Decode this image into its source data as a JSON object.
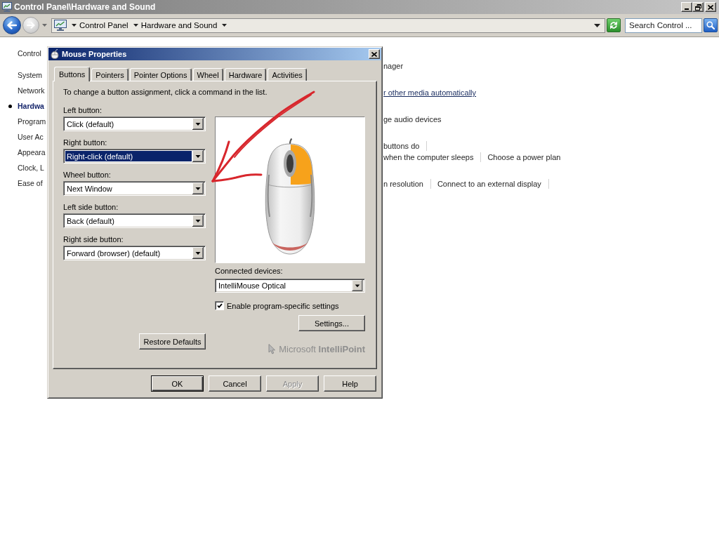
{
  "window": {
    "title": "Control Panel\\Hardware and Sound"
  },
  "address_bar": {
    "back": {
      "disabled": false
    },
    "forward": {
      "disabled": true
    },
    "breadcrumbs": [
      "Control Panel",
      "Hardware and Sound"
    ],
    "search": {
      "placeholder": "Search Control ..."
    }
  },
  "sidebar": {
    "items": [
      {
        "kind": "home",
        "label": "Control",
        "selected": false
      },
      {
        "kind": "category",
        "label": "System",
        "selected": false
      },
      {
        "kind": "category",
        "label": "Network",
        "selected": false
      },
      {
        "kind": "category",
        "label": "Hardwa",
        "selected": true
      },
      {
        "kind": "category",
        "label": "Program",
        "selected": false
      },
      {
        "kind": "category",
        "label": "User Ac",
        "selected": false
      },
      {
        "kind": "category",
        "label": "Appeara",
        "selected": false
      },
      {
        "kind": "category",
        "label": "Clock, L",
        "selected": false
      },
      {
        "kind": "category",
        "label": "Ease of",
        "selected": false
      }
    ]
  },
  "content": {
    "groups": [
      {
        "lines": [
          [
            {
              "label": "nager",
              "underlined": false,
              "divider": false
            }
          ]
        ]
      },
      {
        "lines": [
          [
            {
              "label": "r other media automatically",
              "underlined": true,
              "divider": false
            }
          ]
        ]
      },
      {
        "lines": [
          [
            {
              "label": "ge audio devices",
              "underlined": false,
              "divider": false
            }
          ]
        ]
      },
      {
        "lines": [
          [
            {
              "label": "buttons do",
              "underlined": false,
              "divider": true
            }
          ],
          [
            {
              "label": "when the computer sleeps",
              "underlined": false,
              "divider": true
            },
            {
              "label": "Choose a power plan",
              "underlined": false,
              "divider": false
            }
          ]
        ]
      },
      {
        "lines": [
          [
            {
              "label": "n resolution",
              "underlined": false,
              "divider": true
            },
            {
              "label": "Connect to an external display",
              "underlined": false,
              "divider": true
            }
          ]
        ]
      }
    ]
  },
  "dialog": {
    "title": "Mouse Properties",
    "tabs": [
      {
        "label": "Buttons",
        "selected": true
      },
      {
        "label": "Pointers",
        "selected": false
      },
      {
        "label": "Pointer Options",
        "selected": false
      },
      {
        "label": "Wheel",
        "selected": false
      },
      {
        "label": "Hardware",
        "selected": false
      },
      {
        "label": "Activities",
        "selected": false
      }
    ],
    "instruction": "To change a button assignment, click a command in the list.",
    "assignments": [
      {
        "label": "Left button:",
        "value": "Click (default)",
        "focused": false
      },
      {
        "label": "Right button:",
        "value": "Right-click (default)",
        "focused": true
      },
      {
        "label": "Wheel button:",
        "value": "Next Window",
        "focused": false
      },
      {
        "label": "Left side button:",
        "value": "Back (default)",
        "focused": false
      },
      {
        "label": "Right side button:",
        "value": "Forward (browser) (default)",
        "focused": false
      }
    ],
    "restore_button": "Restore Defaults",
    "devices": {
      "label": "Connected devices:",
      "value": "IntelliMouse Optical"
    },
    "program_settings": {
      "label": "Enable program-specific settings",
      "checked": true
    },
    "settings_button": "Settings...",
    "brand": "Microsoft **IntelliPoint**",
    "buttons": [
      {
        "label": "OK",
        "default": true,
        "disabled": false
      },
      {
        "label": "Cancel",
        "default": false,
        "disabled": false
      },
      {
        "label": "Apply",
        "default": false,
        "disabled": true
      },
      {
        "label": "Help",
        "default": false,
        "disabled": false
      }
    ]
  }
}
